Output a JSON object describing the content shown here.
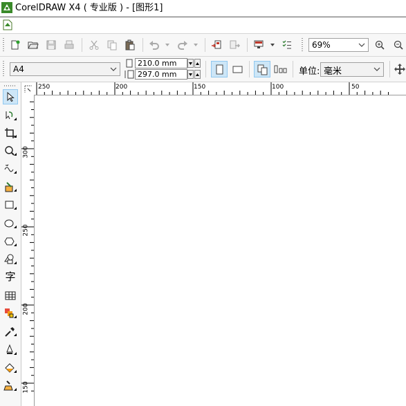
{
  "window": {
    "title": "CorelDRAW X4 ( 专业版 ) - [图形1]",
    "icon": "coreldraw-balloon-icon"
  },
  "menubar": {
    "document_icon": "document-icon"
  },
  "toolbar_standard": {
    "buttons": [
      "new-icon",
      "open-icon",
      "save-icon",
      "print-icon",
      "cut-icon",
      "copy-icon",
      "paste-icon",
      "undo-icon",
      "redo-icon",
      "import-icon",
      "export-icon",
      "application-launcher-icon",
      "options-icon"
    ],
    "zoom_level": "69%"
  },
  "property_bar": {
    "page_size": "A4",
    "width": "210.0 mm",
    "height": "297.0 mm",
    "units_label": "单位:",
    "units_value": "毫米"
  },
  "rulers": {
    "horizontal_ticks": [
      "250",
      "200",
      "150",
      "100",
      "50"
    ],
    "vertical_ticks": [
      "300",
      "250",
      "200",
      "150"
    ]
  },
  "toolbox": {
    "tools": [
      "pick-tool-icon",
      "shape-tool-icon",
      "crop-tool-icon",
      "zoom-tool-icon",
      "freehand-tool-icon",
      "smart-fill-tool-icon",
      "rectangle-tool-icon",
      "ellipse-tool-icon",
      "polygon-tool-icon",
      "basic-shapes-tool-icon",
      "text-tool-icon",
      "table-tool-icon",
      "interactive-blend-tool-icon",
      "eyedropper-tool-icon",
      "outline-tool-icon",
      "fill-tool-icon",
      "interactive-fill-tool-icon"
    ],
    "text_tool_glyph": "字"
  },
  "colors": {
    "selected_bg": "#cde6f7",
    "selected_border": "#90c8f0",
    "toolbar_bg": "#f7f7f7"
  }
}
